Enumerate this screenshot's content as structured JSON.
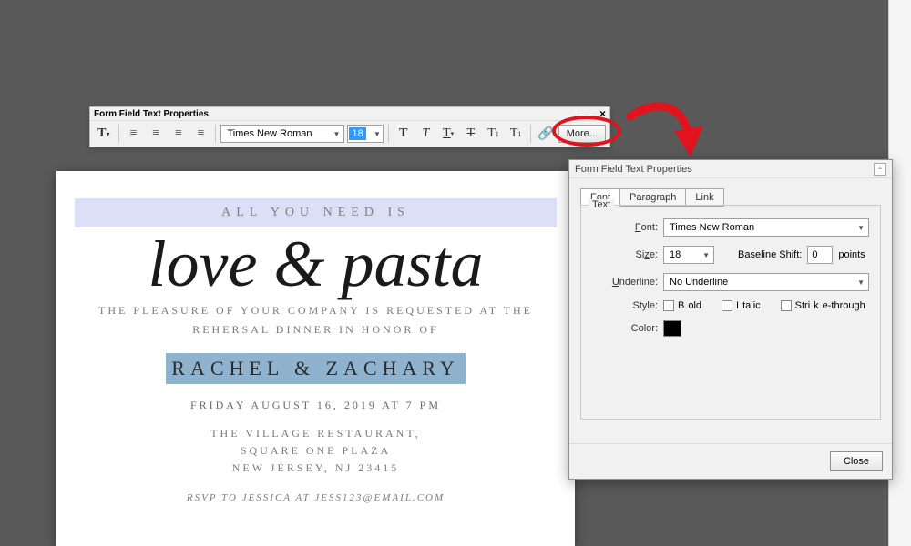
{
  "toolbar": {
    "title": "Form Field Text Properties",
    "font": "Times New Roman",
    "size": "18",
    "more_label": "More..."
  },
  "doc": {
    "band": "ALL YOU NEED IS",
    "script": "love & pasta",
    "pleasure1": "THE PLEASURE OF YOUR COMPANY IS REQUESTED AT THE",
    "pleasure2": "REHERSAL DINNER IN HONOR OF",
    "names": "RACHEL & ZACHARY",
    "date": "FRIDAY AUGUST 16, 2019 AT 7 PM",
    "addr1": "THE VILLAGE RESTAURANT,",
    "addr2": "SQUARE ONE PLAZA",
    "addr3": "NEW JERSEY, NJ 23415",
    "rsvp": "RSVP TO JESSICA AT JESS123@EMAIL.COM"
  },
  "dialog": {
    "title": "Form Field Text Properties",
    "tabs": {
      "font": "Font",
      "paragraph": "Paragraph",
      "link": "Link"
    },
    "group_legend": "Text",
    "labels": {
      "font": "Font:",
      "size": "Size:",
      "baseline": "Baseline Shift:",
      "points": "points",
      "underline": "Underline:",
      "style": "Style:",
      "bold": "Bold",
      "italic": "Italic",
      "strike": "Strike-through",
      "color": "Color:"
    },
    "values": {
      "font": "Times New Roman",
      "size": "18",
      "baseline": "0",
      "underline": "No Underline",
      "color": "#000000"
    },
    "close": "Close"
  }
}
